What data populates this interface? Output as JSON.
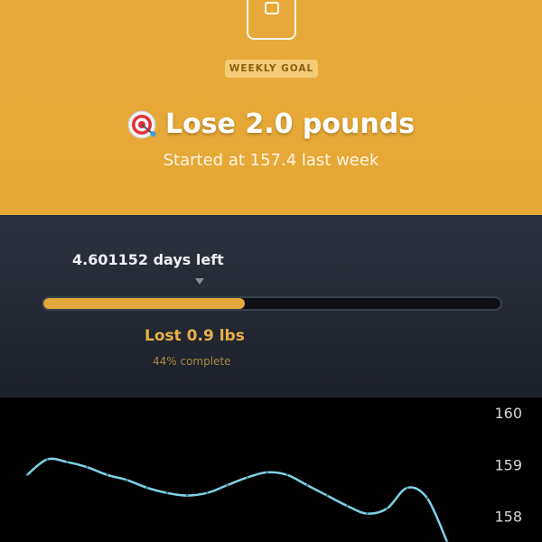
{
  "goal": {
    "badge": "WEEKLY GOAL",
    "title": "Lose 2.0 pounds",
    "subtitle": "Started at 157.4 last week",
    "icons": {
      "header": "scale-icon",
      "title": "target-icon"
    }
  },
  "progress": {
    "days_left": "4.601152 days left",
    "lost": "Lost 0.9 lbs",
    "complete": "44% complete",
    "fraction": 0.44,
    "colors": {
      "fill": "#e3a83c",
      "accent_text": "#e8b145"
    }
  },
  "chart_data": {
    "type": "line",
    "y_ticks": [
      "160",
      "159",
      "158"
    ],
    "ylim": [
      157.5,
      160.3
    ],
    "line_color": "#7fd3e6",
    "series": [
      {
        "values": [
          158.8,
          159.1,
          159.05,
          158.95,
          158.8,
          158.7,
          158.55,
          158.45,
          158.4,
          158.45,
          158.6,
          158.75,
          158.85,
          158.8,
          158.6,
          158.4,
          158.2,
          158.05,
          158.15,
          158.55,
          158.35,
          157.5
        ]
      }
    ],
    "grid": false,
    "legend": "none"
  }
}
